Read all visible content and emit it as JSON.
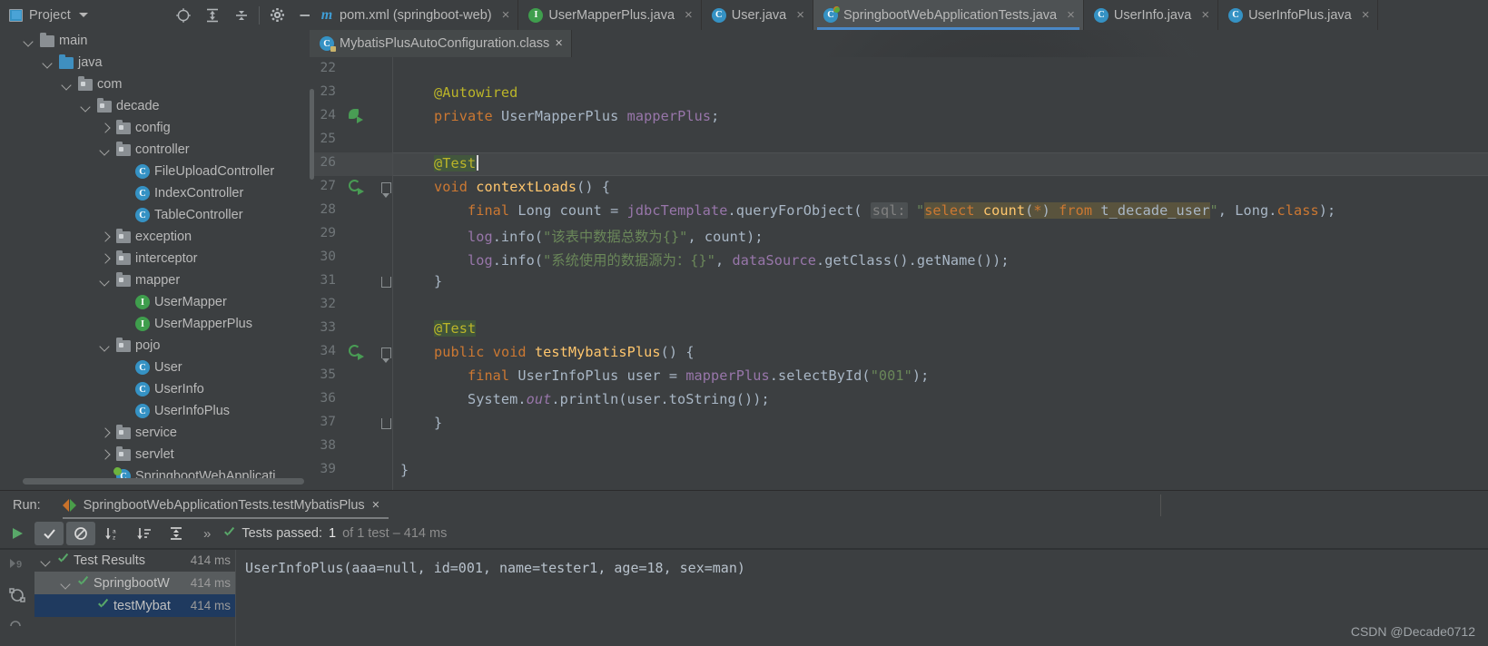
{
  "window": {
    "project_panel_title": "Project",
    "watermark": "CSDN @Decade0712"
  },
  "toolbar_icons": [
    {
      "name": "locate-icon",
      "glyph": "target"
    },
    {
      "name": "expand-all-icon",
      "glyph": "expand"
    },
    {
      "name": "collapse-all-icon",
      "glyph": "collapse"
    },
    {
      "name": "settings-gear-icon",
      "glyph": "gear"
    },
    {
      "name": "hide-panel-icon",
      "glyph": "minus"
    }
  ],
  "tabs": {
    "row1": [
      {
        "label": "pom.xml (springboot-web)",
        "icon": "maven-icon",
        "badge": "m",
        "type": "maven",
        "active": false
      },
      {
        "label": "UserMapperPlus.java",
        "icon": "interface-icon",
        "badge": "I",
        "type": "iface",
        "active": false
      },
      {
        "label": "User.java",
        "icon": "class-icon",
        "badge": "C",
        "type": "class",
        "active": false
      },
      {
        "label": "SpringbootWebApplicationTests.java",
        "icon": "test-class-icon",
        "badge": "C",
        "type": "test",
        "active": true
      },
      {
        "label": "UserInfo.java",
        "icon": "class-icon",
        "badge": "C",
        "type": "class",
        "active": false
      },
      {
        "label": "UserInfoPlus.java",
        "icon": "class-icon",
        "badge": "C",
        "type": "class",
        "active": false
      }
    ],
    "row2": [
      {
        "label": "MybatisPlusAutoConfiguration.class",
        "icon": "class-file-icon",
        "badge": "C",
        "type": "lock"
      }
    ],
    "close_glyph": "×"
  },
  "project_tree": [
    {
      "label": "main",
      "depth": 1,
      "arrow": "down",
      "icon": "folder-icon",
      "kind": "folder"
    },
    {
      "label": "java",
      "depth": 2,
      "arrow": "down",
      "icon": "source-folder-icon",
      "kind": "src"
    },
    {
      "label": "com",
      "depth": 3,
      "arrow": "down",
      "icon": "package-icon",
      "kind": "pkg"
    },
    {
      "label": "decade",
      "depth": 4,
      "arrow": "down",
      "icon": "package-icon",
      "kind": "pkg"
    },
    {
      "label": "config",
      "depth": 5,
      "arrow": "right",
      "icon": "package-icon",
      "kind": "pkg"
    },
    {
      "label": "controller",
      "depth": 5,
      "arrow": "down",
      "icon": "package-icon",
      "kind": "pkg"
    },
    {
      "label": "FileUploadController",
      "depth": 6,
      "arrow": "none",
      "icon": "class-icon",
      "kind": "class",
      "badge": "C"
    },
    {
      "label": "IndexController",
      "depth": 6,
      "arrow": "none",
      "icon": "class-icon",
      "kind": "class",
      "badge": "C"
    },
    {
      "label": "TableController",
      "depth": 6,
      "arrow": "none",
      "icon": "class-icon",
      "kind": "class",
      "badge": "C"
    },
    {
      "label": "exception",
      "depth": 5,
      "arrow": "right",
      "icon": "package-icon",
      "kind": "pkg"
    },
    {
      "label": "interceptor",
      "depth": 5,
      "arrow": "right",
      "icon": "package-icon",
      "kind": "pkg"
    },
    {
      "label": "mapper",
      "depth": 5,
      "arrow": "down",
      "icon": "package-icon",
      "kind": "pkg"
    },
    {
      "label": "UserMapper",
      "depth": 6,
      "arrow": "none",
      "icon": "interface-icon",
      "kind": "iface",
      "badge": "I"
    },
    {
      "label": "UserMapperPlus",
      "depth": 6,
      "arrow": "none",
      "icon": "interface-icon",
      "kind": "iface",
      "badge": "I"
    },
    {
      "label": "pojo",
      "depth": 5,
      "arrow": "down",
      "icon": "package-icon",
      "kind": "pkg"
    },
    {
      "label": "User",
      "depth": 6,
      "arrow": "none",
      "icon": "class-icon",
      "kind": "class",
      "badge": "C"
    },
    {
      "label": "UserInfo",
      "depth": 6,
      "arrow": "none",
      "icon": "class-icon",
      "kind": "class",
      "badge": "C"
    },
    {
      "label": "UserInfoPlus",
      "depth": 6,
      "arrow": "none",
      "icon": "class-icon",
      "kind": "class",
      "badge": "C"
    },
    {
      "label": "service",
      "depth": 5,
      "arrow": "right",
      "icon": "package-icon",
      "kind": "pkg"
    },
    {
      "label": "servlet",
      "depth": 5,
      "arrow": "right",
      "icon": "package-icon",
      "kind": "pkg"
    },
    {
      "label": "SpringbootWebApplicati",
      "depth": 5,
      "arrow": "none",
      "icon": "spring-class-icon",
      "kind": "spring",
      "badge": "C"
    }
  ],
  "editor": {
    "first_line": 22,
    "caret_line": 26,
    "lines": [
      {
        "n": 22,
        "text": "",
        "marker": "",
        "fold": ""
      },
      {
        "n": 23,
        "text": "    @Autowired",
        "marker": "",
        "fold": ""
      },
      {
        "n": 24,
        "text": "    private UserMapperPlus mapperPlus;",
        "marker": "bean",
        "fold": ""
      },
      {
        "n": 25,
        "text": "",
        "marker": "",
        "fold": ""
      },
      {
        "n": 26,
        "text": "    @Test",
        "marker": "",
        "fold": ""
      },
      {
        "n": 27,
        "text": "    void contextLoads() {",
        "marker": "run",
        "fold": "top"
      },
      {
        "n": 28,
        "text": "        final Long count = jdbcTemplate.queryForObject( sql: \"select count(*) from t_decade_user\", Long.class);",
        "marker": "",
        "fold": ""
      },
      {
        "n": 29,
        "text": "        log.info(\"该表中数据总数为{}\", count);",
        "marker": "",
        "fold": ""
      },
      {
        "n": 30,
        "text": "        log.info(\"系统使用的数据源为：{}\", dataSource.getClass().getName());",
        "marker": "",
        "fold": ""
      },
      {
        "n": 31,
        "text": "    }",
        "marker": "",
        "fold": "bot"
      },
      {
        "n": 32,
        "text": "",
        "marker": "",
        "fold": ""
      },
      {
        "n": 33,
        "text": "    @Test",
        "marker": "",
        "fold": ""
      },
      {
        "n": 34,
        "text": "    public void testMybatisPlus() {",
        "marker": "run",
        "fold": "top"
      },
      {
        "n": 35,
        "text": "        final UserInfoPlus user = mapperPlus.selectById(\"001\");",
        "marker": "",
        "fold": ""
      },
      {
        "n": 36,
        "text": "        System.out.println(user.toString());",
        "marker": "",
        "fold": ""
      },
      {
        "n": 37,
        "text": "    }",
        "marker": "",
        "fold": "bot"
      },
      {
        "n": 38,
        "text": "",
        "marker": "",
        "fold": ""
      },
      {
        "n": 39,
        "text": "}",
        "marker": "",
        "fold": ""
      }
    ],
    "parameter_hint": "sql:",
    "sql_string": "select count(*) from t_decade_user"
  },
  "run_panel": {
    "run_label": "Run:",
    "configuration_name": "SpringbootWebApplicationTests.testMybatisPlus",
    "close_glyph": "×",
    "toolbar": [
      {
        "name": "rerun-button",
        "glyph": "play"
      },
      {
        "name": "show-passed-toggle",
        "glyph": "check",
        "pressed": true
      },
      {
        "name": "show-ignored-toggle",
        "glyph": "ban",
        "pressed": true
      },
      {
        "name": "sort-alphabetically-button",
        "glyph": "sort-az"
      },
      {
        "name": "sort-by-duration-button",
        "glyph": "sort-duration"
      },
      {
        "name": "expand-collapse-button",
        "glyph": "expand"
      },
      {
        "name": "more-options-button",
        "glyph": "»"
      }
    ],
    "status": {
      "prefix": "Tests passed:",
      "count": "1",
      "suffix": "of 1 test – 414 ms"
    },
    "results": [
      {
        "label": "Test Results",
        "time": "414 ms",
        "depth": 0,
        "arrow": "down",
        "state": "passed",
        "selection": "none"
      },
      {
        "label": "SpringbootW",
        "time": "414 ms",
        "depth": 1,
        "arrow": "down",
        "state": "passed",
        "selection": "gray"
      },
      {
        "label": "testMybat",
        "time": "414 ms",
        "depth": 2,
        "arrow": "none",
        "state": "passed",
        "selection": "blue"
      }
    ],
    "console_output": "UserInfoPlus(aaa=null, id=001, name=tester1, age=18, sex=man)"
  },
  "colors": {
    "accent_blue": "#4a88c7",
    "pass_green": "#59a869",
    "annotation_yellow": "#bbb529",
    "keyword_orange": "#cc7832",
    "string_green": "#6a8759",
    "field_purple": "#9876aa",
    "method_yellow": "#ffc66d",
    "bg": "#3c3f41"
  }
}
